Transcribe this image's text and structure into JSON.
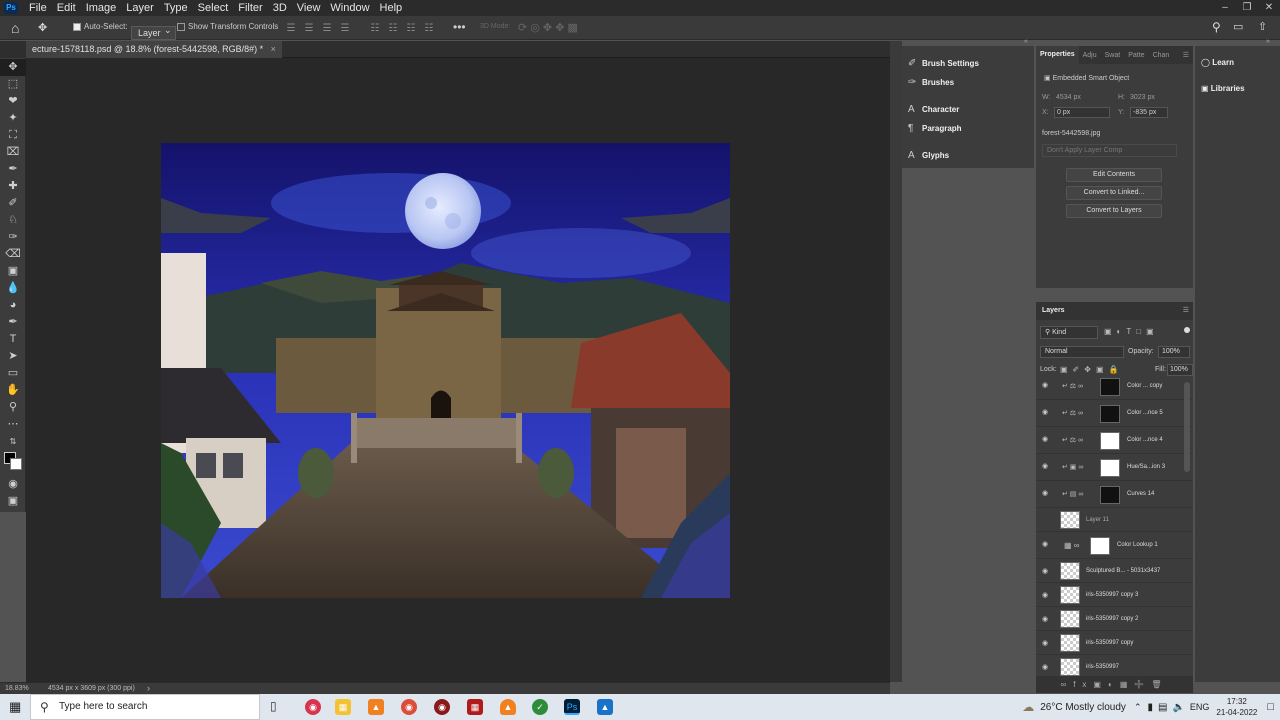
{
  "menubar": {
    "logo": "Ps",
    "items": [
      "File",
      "Edit",
      "Image",
      "Layer",
      "Type",
      "Select",
      "Filter",
      "3D",
      "View",
      "Window",
      "Help"
    ]
  },
  "options": {
    "auto_select_label": "Auto-Select:",
    "auto_select_target": "Layer",
    "show_transform_label": "Show Transform Controls",
    "three_d_mode": "3D Mode:"
  },
  "document": {
    "tab_title": "ecture-1578118.psd @ 18.8% (forest-5442598, RGB/8#) *",
    "zoom": "18.83%",
    "dimensions": "4534 px x 3609 px (300 ppi)"
  },
  "panels": {
    "brush_settings": "Brush Settings",
    "brushes": "Brushes",
    "character": "Character",
    "paragraph": "Paragraph",
    "glyphs": "Glyphs",
    "learn": "Learn",
    "libraries": "Libraries"
  },
  "properties": {
    "tabs": [
      "Properties",
      "Adju",
      "Swat",
      "Patte",
      "Chan"
    ],
    "type": "Embedded Smart Object",
    "w_label": "W:",
    "w_value": "4534 px",
    "h_label": "H:",
    "h_value": "3023 px",
    "x_label": "X:",
    "x_value": "0 px",
    "y_label": "Y:",
    "y_value": "-835 px",
    "filename": "forest-5442598.jpg",
    "layer_comp": "Don't Apply Layer Comp",
    "edit_contents": "Edit Contents",
    "convert_linked": "Convert to Linked...",
    "convert_layers": "Convert to Layers"
  },
  "layers": {
    "title": "Layers",
    "kind": "Kind",
    "blend_mode": "Normal",
    "opacity_label": "Opacity:",
    "opacity_value": "100%",
    "lock_label": "Lock:",
    "fill_label": "Fill:",
    "fill_value": "100%",
    "rows": [
      {
        "name": "Color ... copy"
      },
      {
        "name": "Color ...nce 5"
      },
      {
        "name": "Color ...nce 4"
      },
      {
        "name": "Hue/Sa...ion 3"
      },
      {
        "name": "Curves 14"
      },
      {
        "name": "Layer 11"
      },
      {
        "name": "Color Lookup 1"
      },
      {
        "name": "Sculptured B... - 5031x3437"
      },
      {
        "name": "iris-5350997 copy 3"
      },
      {
        "name": "iris-5350997 copy 2"
      },
      {
        "name": "iris-5350997 copy"
      },
      {
        "name": "iris-5350997"
      }
    ]
  },
  "taskbar": {
    "search_placeholder": "Type here to search",
    "weather": "26°C  Mostly cloudy",
    "lang": "ENG",
    "time": "17:32",
    "date": "21-04-2022"
  }
}
